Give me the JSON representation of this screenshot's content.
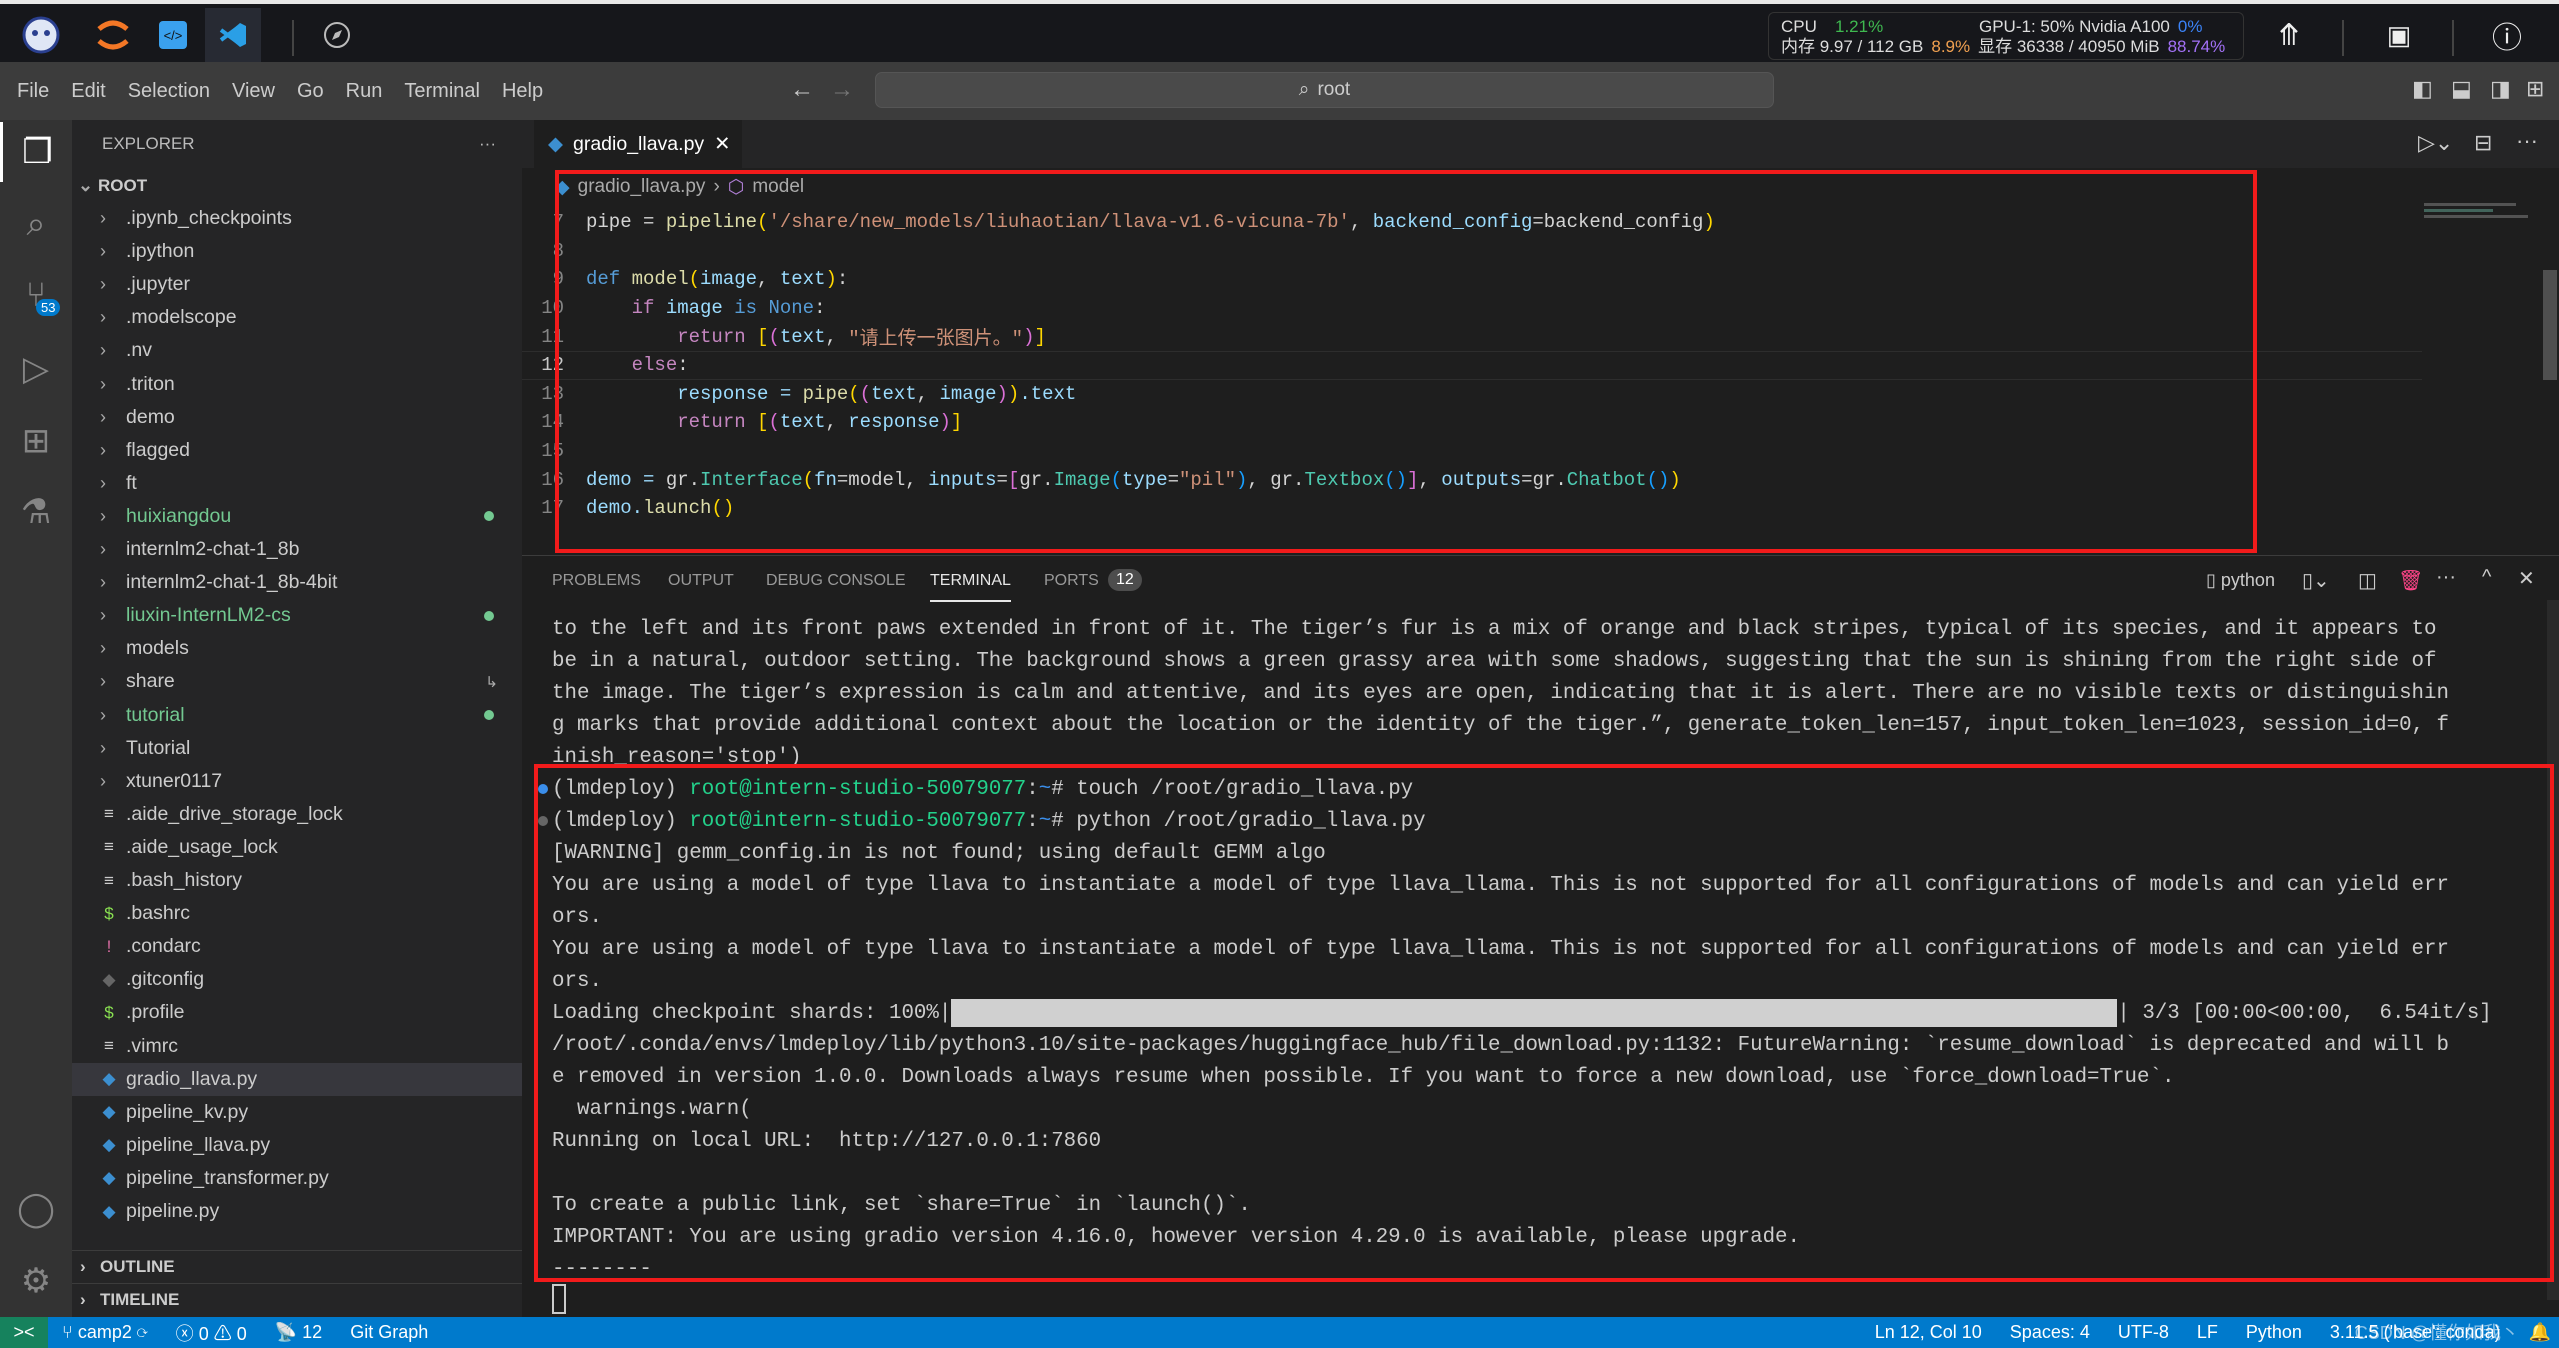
{
  "topbar": {
    "apps": [
      "intern-studio-logo",
      "jupyter-icon",
      "code-server-icon",
      "vscode-icon",
      "compass-icon"
    ],
    "stats": {
      "cpu_label": "CPU",
      "cpu_value": "1.21%",
      "gpu_label": "GPU-1: 50% Nvidia A100",
      "gpu_value": "0%",
      "mem_label": "内存 9.97 / 112 GB",
      "mem_value": "8.9%",
      "vram_label": "显存 36338 / 40950 MiB",
      "vram_value": "88.74%"
    },
    "colors": {
      "cpu": "#3fb950",
      "gpu": "#3b82f6",
      "mem": "#f0a050",
      "vram": "#a371f7"
    }
  },
  "menu": [
    "File",
    "Edit",
    "Selection",
    "View",
    "Go",
    "Run",
    "Terminal",
    "Help"
  ],
  "command_center": "root",
  "activity": {
    "scm_badge": "53"
  },
  "sidebar": {
    "title": "EXPLORER",
    "root": "ROOT",
    "items": [
      {
        "label": ".ipynb_checkpoints",
        "type": "folder"
      },
      {
        "label": ".ipython",
        "type": "folder"
      },
      {
        "label": ".jupyter",
        "type": "folder"
      },
      {
        "label": ".modelscope",
        "type": "folder"
      },
      {
        "label": ".nv",
        "type": "folder"
      },
      {
        "label": ".triton",
        "type": "folder"
      },
      {
        "label": "demo",
        "type": "folder"
      },
      {
        "label": "flagged",
        "type": "folder"
      },
      {
        "label": "ft",
        "type": "folder"
      },
      {
        "label": "huixiangdou",
        "type": "folder",
        "status": "modified"
      },
      {
        "label": "internlm2-chat-1_8b",
        "type": "folder"
      },
      {
        "label": "internlm2-chat-1_8b-4bit",
        "type": "folder"
      },
      {
        "label": "liuxin-InternLM2-cs",
        "type": "folder",
        "status": "modified"
      },
      {
        "label": "models",
        "type": "folder"
      },
      {
        "label": "share",
        "type": "folder",
        "status": "link"
      },
      {
        "label": "tutorial",
        "type": "folder",
        "status": "modified"
      },
      {
        "label": "Tutorial",
        "type": "folder"
      },
      {
        "label": "xtuner0117",
        "type": "folder"
      },
      {
        "label": ".aide_drive_storage_lock",
        "type": "text"
      },
      {
        "label": ".aide_usage_lock",
        "type": "text"
      },
      {
        "label": ".bash_history",
        "type": "text"
      },
      {
        "label": ".bashrc",
        "type": "shell"
      },
      {
        "label": ".condarc",
        "type": "yaml"
      },
      {
        "label": ".gitconfig",
        "type": "git"
      },
      {
        "label": ".profile",
        "type": "shell"
      },
      {
        "label": ".vimrc",
        "type": "text"
      },
      {
        "label": "gradio_llava.py",
        "type": "python",
        "selected": true
      },
      {
        "label": "pipeline_kv.py",
        "type": "python"
      },
      {
        "label": "pipeline_llava.py",
        "type": "python"
      },
      {
        "label": "pipeline_transformer.py",
        "type": "python"
      },
      {
        "label": "pipeline.py",
        "type": "python"
      }
    ],
    "outline": "OUTLINE",
    "timeline": "TIMELINE"
  },
  "editor": {
    "tab": "gradio_llava.py",
    "breadcrumb": [
      "gradio_llava.py",
      "model"
    ],
    "current_line": 12,
    "lines": [
      {
        "n": "7",
        "tokens": [
          [
            "pipe = ",
            "df"
          ],
          [
            "pipeline",
            "fn"
          ],
          [
            "(",
            "b1"
          ],
          [
            "'/share/new_models/liuhaotian/llava-v1.6-vicuna-7b'",
            "st"
          ],
          [
            ", ",
            "df"
          ],
          [
            "backend_config",
            "pa"
          ],
          [
            "=backend_config",
            "df"
          ],
          [
            ")",
            "b1"
          ]
        ]
      },
      {
        "n": "8",
        "tokens": []
      },
      {
        "n": "9",
        "tokens": [
          [
            "def ",
            "kw"
          ],
          [
            "model",
            "fn"
          ],
          [
            "(",
            "b1"
          ],
          [
            "image",
            "pa"
          ],
          [
            ", ",
            "df"
          ],
          [
            "text",
            "pa"
          ],
          [
            ")",
            "b1"
          ],
          [
            ":",
            "df"
          ]
        ]
      },
      {
        "n": "10",
        "tokens": [
          [
            "    ",
            "df"
          ],
          [
            "if ",
            "kw2"
          ],
          [
            "image ",
            "pa"
          ],
          [
            "is ",
            "kw"
          ],
          [
            "None",
            "kw"
          ],
          [
            ":",
            "df"
          ]
        ]
      },
      {
        "n": "11",
        "tokens": [
          [
            "        ",
            "df"
          ],
          [
            "return ",
            "kw2"
          ],
          [
            "[",
            "b1"
          ],
          [
            "(",
            "b2"
          ],
          [
            "text",
            "pa"
          ],
          [
            ", ",
            "df"
          ],
          [
            "\"请上传一张图片。\"",
            "st"
          ],
          [
            ")",
            "b2"
          ],
          [
            "]",
            "b1"
          ]
        ]
      },
      {
        "n": "12",
        "tokens": [
          [
            "    ",
            "df"
          ],
          [
            "else",
            "kw2"
          ],
          [
            ":",
            "df"
          ]
        ]
      },
      {
        "n": "13",
        "tokens": [
          [
            "        ",
            "df"
          ],
          [
            "response = ",
            "pa"
          ],
          [
            "pipe",
            "fn"
          ],
          [
            "(",
            "b1"
          ],
          [
            "(",
            "b2"
          ],
          [
            "text",
            "pa"
          ],
          [
            ", ",
            "df"
          ],
          [
            "image",
            "pa"
          ],
          [
            ")",
            "b2"
          ],
          [
            ")",
            "b1"
          ],
          [
            ".text",
            "pa"
          ]
        ]
      },
      {
        "n": "14",
        "tokens": [
          [
            "        ",
            "df"
          ],
          [
            "return ",
            "kw2"
          ],
          [
            "[",
            "b1"
          ],
          [
            "(",
            "b2"
          ],
          [
            "text",
            "pa"
          ],
          [
            ", ",
            "df"
          ],
          [
            "response",
            "pa"
          ],
          [
            ")",
            "b2"
          ],
          [
            "]",
            "b1"
          ]
        ]
      },
      {
        "n": "15",
        "tokens": []
      },
      {
        "n": "16",
        "tokens": [
          [
            "demo = ",
            "pa"
          ],
          [
            "gr",
            "df"
          ],
          [
            ".",
            "df"
          ],
          [
            "Interface",
            "cls"
          ],
          [
            "(",
            "b1"
          ],
          [
            "fn",
            "pa"
          ],
          [
            "=model, ",
            "df"
          ],
          [
            "inputs",
            "pa"
          ],
          [
            "=",
            "df"
          ],
          [
            "[",
            "b2"
          ],
          [
            "gr.",
            "df"
          ],
          [
            "Image",
            "cls"
          ],
          [
            "(",
            "b3"
          ],
          [
            "type",
            "pa"
          ],
          [
            "=",
            "df"
          ],
          [
            "\"pil\"",
            "st"
          ],
          [
            ")",
            "b3"
          ],
          [
            ", gr.",
            "df"
          ],
          [
            "Textbox",
            "cls"
          ],
          [
            "()",
            "b3"
          ],
          [
            "]",
            "b2"
          ],
          [
            ", ",
            "df"
          ],
          [
            "outputs",
            "pa"
          ],
          [
            "=gr.",
            "df"
          ],
          [
            "Chatbot",
            "cls"
          ],
          [
            "()",
            "b3"
          ],
          [
            ")",
            "b1"
          ]
        ]
      },
      {
        "n": "17",
        "tokens": [
          [
            "demo.",
            "pa"
          ],
          [
            "launch",
            "fn"
          ],
          [
            "()",
            "b1"
          ]
        ]
      }
    ]
  },
  "panel": {
    "tabs": [
      "PROBLEMS",
      "OUTPUT",
      "DEBUG CONSOLE",
      "TERMINAL",
      "PORTS"
    ],
    "active": "TERMINAL",
    "ports_badge": "12",
    "terminal_name": "python"
  },
  "terminal": {
    "lines": [
      {
        "text": "to the left and its front paws extended in front of it. The tiger’s fur is a mix of orange and black stripes, typical of its species, and it appears to"
      },
      {
        "text": "be in a natural, outdoor setting. The background shows a green grassy area with some shadows, suggesting that the sun is shining from the right side of"
      },
      {
        "text": "the image. The tiger’s expression is calm and attentive, and its eyes are open, indicating that it is alert. There are no visible texts or distinguishin"
      },
      {
        "text": "g marks that provide additional context about the location or the identity of the tiger.”, generate_token_len=157, input_token_len=1023, session_id=0, f"
      },
      {
        "text": "inish_reason='stop')"
      },
      {
        "env": "(lmdeploy) ",
        "host": "root@intern-studio-50079077",
        "path": "~",
        "cmd": "# touch /root/gradio_llava.py"
      },
      {
        "env": "(lmdeploy) ",
        "host": "root@intern-studio-50079077",
        "path": "~",
        "cmd": "# python /root/gradio_llava.py"
      },
      {
        "text": "[WARNING] gemm_config.in is not found; using default GEMM algo"
      },
      {
        "text": "You are using a model of type llava to instantiate a model of type llava_llama. This is not supported for all configurations of models and can yield err"
      },
      {
        "text": "ors."
      },
      {
        "text": "You are using a model of type llava to instantiate a model of type llava_llama. This is not supported for all configurations of models and can yield err"
      },
      {
        "text": "ors."
      },
      {
        "progress_label": "Loading checkpoint shards: 100%|",
        "progress": 1.0,
        "progress_tail": "| 3/3 [00:00<00:00,  6.54it/s]"
      },
      {
        "text": "/root/.conda/envs/lmdeploy/lib/python3.10/site-packages/huggingface_hub/file_download.py:1132: FutureWarning: `resume_download` is deprecated and will b"
      },
      {
        "text": "e removed in version 1.0.0. Downloads always resume when possible. If you want to force a new download, use `force_download=True`."
      },
      {
        "text": "  warnings.warn("
      },
      {
        "text": "Running on local URL:  http://127.0.0.1:7860"
      },
      {
        "text": ""
      },
      {
        "text": "To create a public link, set `share=True` in `launch()`."
      },
      {
        "text": "IMPORTANT: You are using gradio version 4.16.0, however version 4.29.0 is available, please upgrade."
      },
      {
        "text": "--------"
      }
    ]
  },
  "status": {
    "branch": "camp2",
    "errors": "0",
    "warnings": "0",
    "ports": "12",
    "git_graph": "Git Graph",
    "position": "Ln 12, Col 10",
    "spaces": "Spaces: 4",
    "encoding": "UTF-8",
    "eol": "LF",
    "language": "Python",
    "interpreter": "3.11.5 ('base': conda)",
    "watermark": "CSDN @懂你如我丶"
  },
  "highlight_color": "#f21b1b"
}
